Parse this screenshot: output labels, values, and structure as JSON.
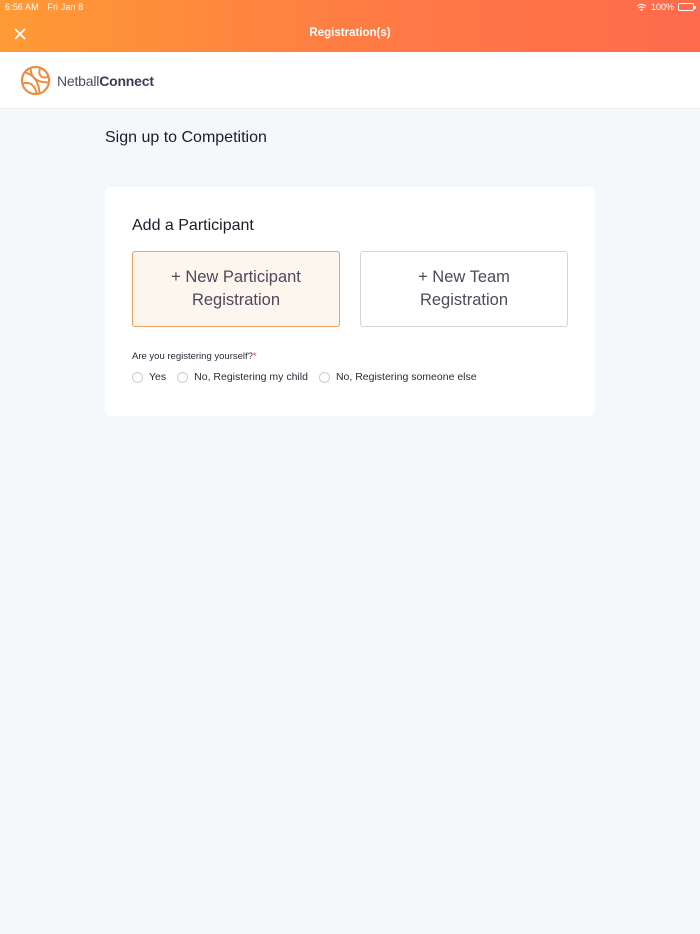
{
  "status_bar": {
    "time": "6:56 AM",
    "date": "Fri Jan 8",
    "battery": "100%"
  },
  "nav": {
    "title": "Registration(s)",
    "close_icon": "close-icon"
  },
  "logo": {
    "text_light": "Netball",
    "text_bold": "Connect"
  },
  "page": {
    "title": "Sign up to Competition"
  },
  "card": {
    "title": "Add a Participant",
    "options": [
      {
        "label": "+ New Participant Registration",
        "selected": true
      },
      {
        "label": "+ New Team Registration",
        "selected": false
      }
    ],
    "question": "Are you registering yourself?",
    "required_mark": "*",
    "radios": [
      {
        "label": "Yes"
      },
      {
        "label": "No, Registering my child"
      },
      {
        "label": "No, Registering someone else"
      }
    ]
  },
  "colors": {
    "accent_start": "#ff9a35",
    "accent_end": "#ff6a4c",
    "selected_border": "#f0a061",
    "selected_bg": "#fdf6ee",
    "required": "#e83a3a"
  }
}
